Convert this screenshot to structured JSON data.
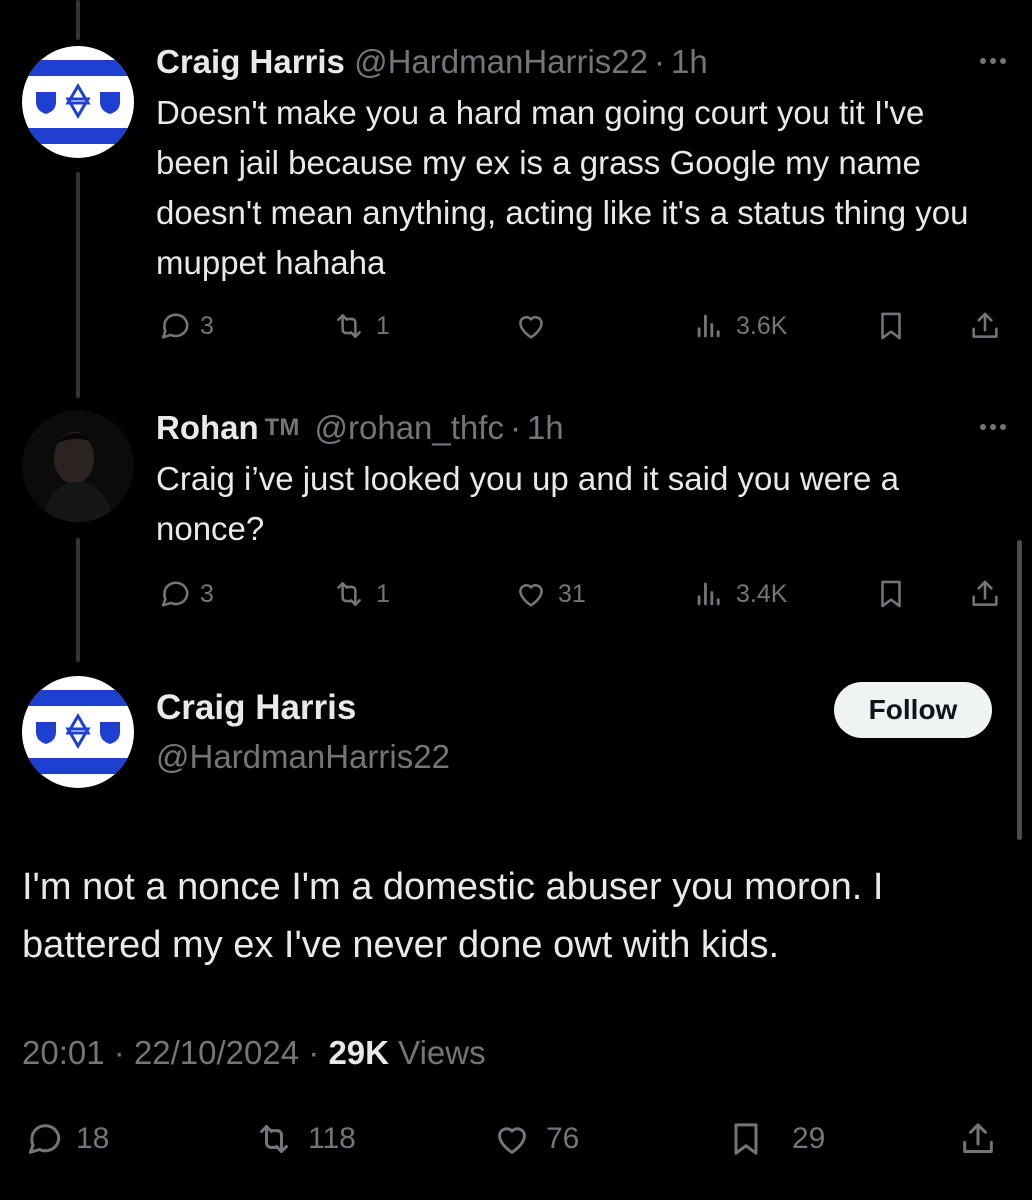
{
  "tweets": [
    {
      "name": "Craig Harris",
      "handle": "@HardmanHarris22",
      "sep": "·",
      "time": "1h",
      "text": "Doesn't make you a hard man going court you tit I've been jail because my ex is a grass Google my name doesn't mean anything, acting like it's a status thing you muppet hahaha",
      "replies": "3",
      "retweets": "1",
      "likes": "",
      "views": "3.6K"
    },
    {
      "name": "Rohan",
      "badge": "TM",
      "handle": "@rohan_thfc",
      "sep": "·",
      "time": "1h",
      "text": "Craig i’ve just looked you up and it said you were a nonce?",
      "replies": "3",
      "retweets": "1",
      "likes": "31",
      "views": "3.4K"
    }
  ],
  "main": {
    "name": "Craig Harris",
    "handle": "@HardmanHarris22",
    "follow_label": "Follow",
    "text": "I'm not a nonce I'm a domestic abuser you moron. I battered my ex I've never done owt with kids.",
    "time": "20:01",
    "sep1": "·",
    "date": "22/10/2024",
    "sep2": "·",
    "views_count": "29K",
    "views_label": "Views",
    "replies": "18",
    "retweets": "118",
    "likes": "76",
    "bookmarks": "29"
  },
  "icons": {
    "reply": "reply-icon",
    "retweet": "retweet-icon",
    "like": "heart-icon",
    "views": "views-icon",
    "bookmark": "bookmark-icon",
    "share": "share-icon",
    "more": "more-icon"
  },
  "colors": {
    "background": "#000000",
    "text": "#e7e9ea",
    "muted": "#71767b",
    "thread_line": "#333639",
    "avatar_blue": "#1f3fd1",
    "follow_bg": "#eff3f4"
  }
}
